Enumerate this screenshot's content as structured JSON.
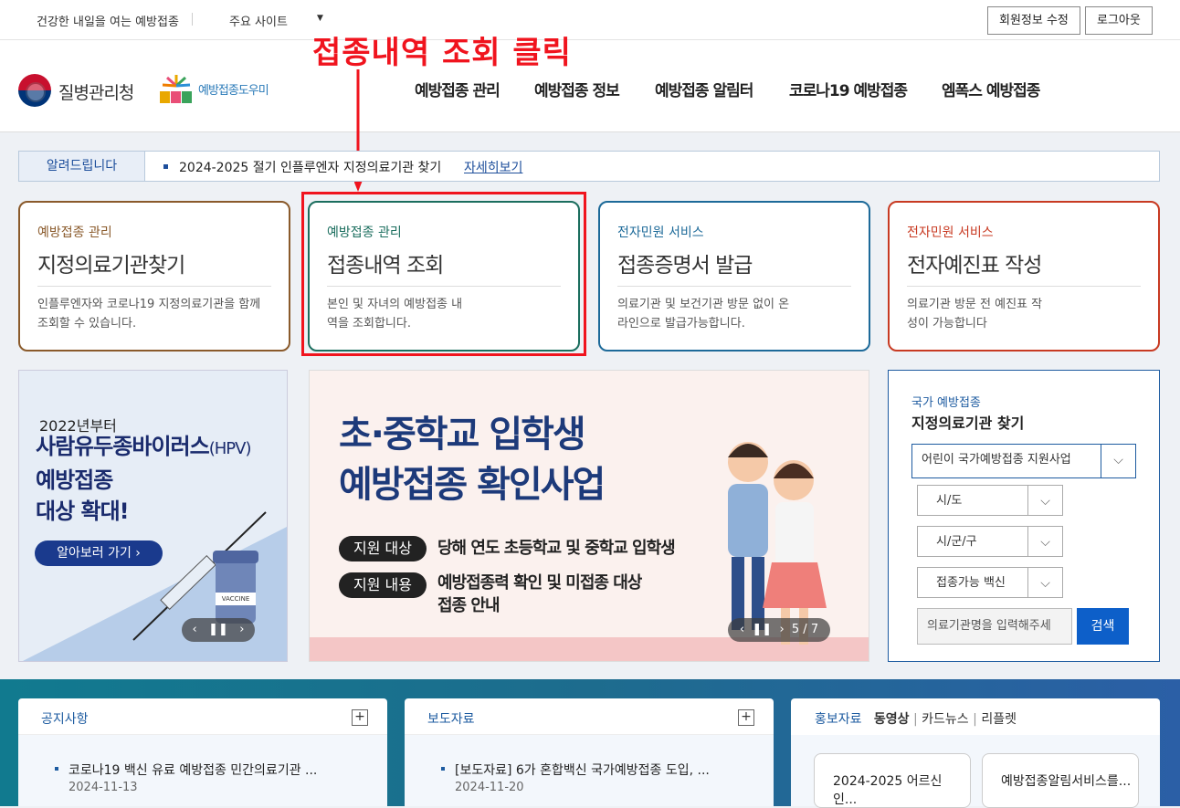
{
  "top": {
    "slogan": "건강한 내일을 여는 예방접종",
    "sites": "주요 사이트",
    "edit_btn": "회원정보 수정",
    "logout_btn": "로그아웃"
  },
  "header": {
    "logo1": "질병관리청",
    "logo2": "예방접종도우미",
    "nav": [
      "예방접종 관리",
      "예방접종 정보",
      "예방접종 알림터",
      "코로나19 예방접종",
      "엠폭스 예방접종"
    ]
  },
  "annotation": "접종내역 조회 클릭",
  "notice": {
    "label": "알려드립니다",
    "text": "2024-2025 절기 인플루엔자 지정의료기관 찾기",
    "more": "자세히보기"
  },
  "cards": [
    {
      "cat": "예방접종 관리",
      "title": "지정의료기관찾기",
      "desc": "인플루엔자와 코로나19 지정의료기관을 함께 조회할 수 있습니다.",
      "color": "#8a5a2b"
    },
    {
      "cat": "예방접종 관리",
      "title": "접종내역 조회",
      "desc": "본인 및 자녀의 예방접종 내역을 조회합니다.",
      "color": "#1b6e5e"
    },
    {
      "cat": "전자민원 서비스",
      "title": "접종증명서 발급",
      "desc": "의료기관 및 보건기관 방문 없이 온라인으로 발급가능합니다.",
      "color": "#1d6a99"
    },
    {
      "cat": "전자민원 서비스",
      "title": "전자예진표 작성",
      "desc": "의료기관 방문 전 예진표 작성이 가능합니다",
      "color": "#c83a22"
    }
  ],
  "banner1": {
    "year": "2022년부터",
    "line1": "사람유두종바이러스",
    "line1_sm": "(HPV)",
    "line2": "예방접종",
    "line3": "대상 확대!",
    "btn": "알아보러 가기 ›",
    "vial": "VACCINE"
  },
  "banner2": {
    "line1": "초·중학교 입학생",
    "line2": "예방접종 확인사업",
    "pill1": "지원 대상",
    "text1": "당해 연도 초등학교 및 중학교 입학생",
    "pill2": "지원 내용",
    "text2a": "예방접종력 확인 및 미접종 대상",
    "text2b": "접종 안내",
    "counter": "5 / 7"
  },
  "search": {
    "sub": "국가 예방접종",
    "title": "지정의료기관 찾기",
    "program": "어린이 국가예방접종 지원사업",
    "sido": "시/도",
    "sigungu": "시/군/구",
    "vaccine": "접종가능 백신",
    "placeholder": "의료기관명을 입력해주세",
    "btn": "검색"
  },
  "panels": {
    "notice": {
      "title": "공지사항",
      "item": "코로나19 백신 유료 예방접종 민간의료기관 ...",
      "date": "2024-11-13"
    },
    "press": {
      "title": "보도자료",
      "item": "[보도자료] 6가 혼합백신 국가예방접종 도입, ...",
      "date": "2024-11-20"
    },
    "promo": {
      "t1": "홍보자료",
      "t2": "동영상",
      "t3": "카드뉴스",
      "t4": "리플렛",
      "thumb1": "2024-2025 어르신 인...",
      "thumb2": "예방접종알림서비스를..."
    }
  }
}
